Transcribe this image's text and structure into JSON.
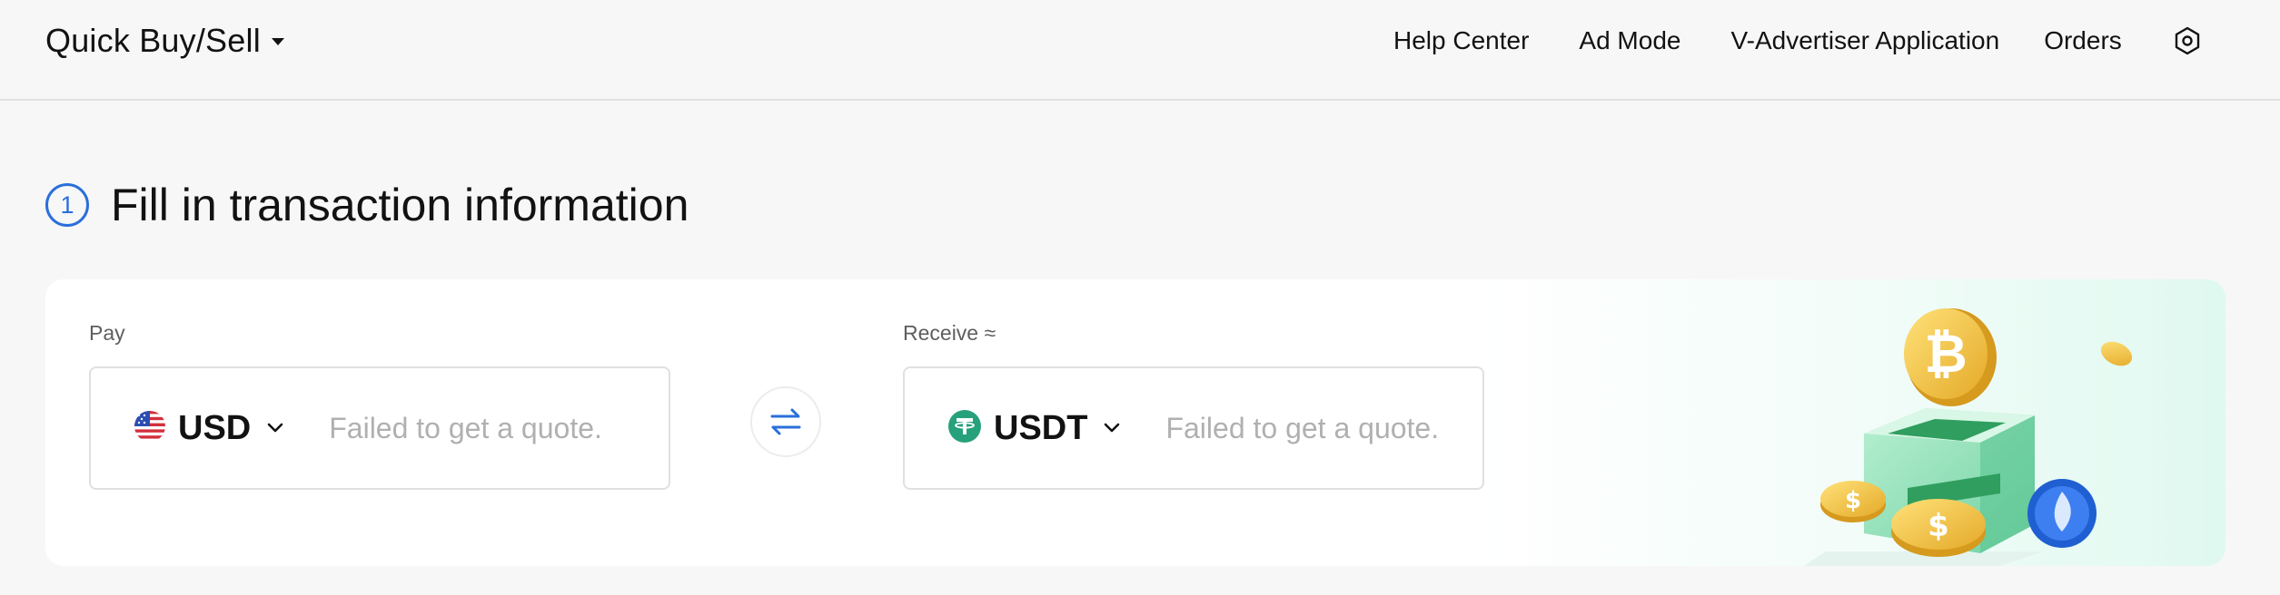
{
  "header": {
    "brand_title": "Quick Buy/Sell",
    "nav": {
      "help_center": "Help Center",
      "ad_mode": "Ad Mode",
      "v_advertiser": "V-Advertiser Application",
      "orders": "Orders"
    },
    "settings_icon": "settings-hexagon-icon"
  },
  "step": {
    "number": "1",
    "title": "Fill in transaction information"
  },
  "form": {
    "pay": {
      "label": "Pay",
      "currency": "USD",
      "currency_icon": "us-flag-icon",
      "placeholder": "Failed to get a quote."
    },
    "receive": {
      "label": "Receive ≈",
      "currency": "USDT",
      "currency_icon": "tether-icon",
      "placeholder": "Failed to get a quote."
    },
    "swap_icon": "swap-arrows-icon"
  },
  "colors": {
    "accent": "#2a6fdb",
    "tether": "#26a17b",
    "border": "#e0e0e0",
    "placeholder": "#b0b0b0"
  }
}
